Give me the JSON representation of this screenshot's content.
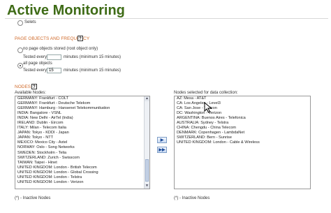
{
  "page": {
    "title": "Active Monitoring"
  },
  "top_option": {
    "label": "Selets"
  },
  "page_objects": {
    "section_title": "PAGE OBJECTS AND FREQUENCY",
    "help": "?",
    "option_no": {
      "label": "no page objects stored (root object only)",
      "tested_prefix": "Tested every",
      "value": "",
      "tested_suffix": "minutes (minimum 15 minutes)"
    },
    "option_all": {
      "label": "all page objects",
      "tested_prefix": "Tested every",
      "value": "15",
      "tested_suffix": "minutes (minimum 15 minutes)"
    }
  },
  "nodes": {
    "section_title": "NODES",
    "help": "?",
    "available": {
      "label": "Available Nodes:",
      "items": [
        "GERMANY: Frankfurt - COLT",
        "GERMANY: Frankfurt - Deutsche Telekom",
        "GERMANY: Hamburg - Hansenet Telekommunikation",
        "INDIA: Bangalore - VSNL",
        "INDIA: New Delhi - AirTel (India)",
        "IRELAND: Dublin - Eircom",
        "ITALY: Milan - Telecom Italia",
        "JAPAN: Tokyo - KDDI - Japan",
        "JAPAN: Tokyo - NTT",
        "MEXICO: Mexico City - Axtel",
        "NORWAY: Oslo - Song Networks",
        "SWEDEN: Stockholm - Telia",
        "SWITZERLAND: Zurich - Swisscom",
        "TAIWAN: Taipei - Hinet",
        "UNITED KINGDOM: London - British Telecom",
        "UNITED KINGDOM: London - Global Crossing",
        "UNITED KINGDOM: London - Telstra",
        "UNITED KINGDOM: London - Verizon"
      ],
      "footnote": "(*) - Inactive Nodes"
    },
    "selected": {
      "label": "Nodes selected for data collection:",
      "items": [
        "AZ: Mesa - AT&T",
        "CA: Los Angeles - Level3",
        "CA: San Jose - Verizon",
        "DC: Washington - Verizon",
        "ARGENTINA: Buenos Aires - Telefonica",
        "AUSTRALIA: Sydney - Telstra",
        "CHINA: Chengdu - China Telecom",
        "DENMARK: Copenhagen - LambdaNet",
        "SWITZERLAND: Bern - Sunrise",
        "UNITED KINGDOM: London - Cable & Wireless"
      ],
      "footnote": "(*) - Inactive Nodes"
    },
    "buttons": {
      "add": "▶",
      "add_all": "▶▶"
    }
  },
  "scroll_icons": {
    "up": "▲",
    "down": "▼"
  }
}
